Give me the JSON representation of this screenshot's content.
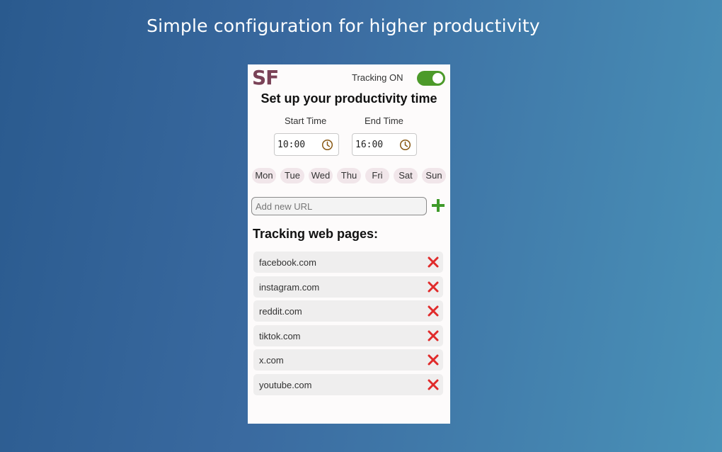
{
  "headline": "Simple configuration for higher productivity",
  "popup": {
    "logo": "SF",
    "tracking_label": "Tracking ON",
    "tracking_enabled": true,
    "title": "Set up your productivity time",
    "start_time": {
      "label": "Start Time",
      "value": "10:00"
    },
    "end_time": {
      "label": "End Time",
      "value": "16:00"
    },
    "days": [
      {
        "label": "Mon"
      },
      {
        "label": "Tue"
      },
      {
        "label": "Wed"
      },
      {
        "label": "Thu"
      },
      {
        "label": "Fri"
      },
      {
        "label": "Sat"
      },
      {
        "label": "Sun"
      }
    ],
    "url_input": {
      "placeholder": "Add new URL",
      "value": ""
    },
    "list_title": "Tracking web pages:",
    "sites": [
      {
        "name": "facebook.com"
      },
      {
        "name": "instagram.com"
      },
      {
        "name": "reddit.com"
      },
      {
        "name": "tiktok.com"
      },
      {
        "name": "x.com"
      },
      {
        "name": "youtube.com"
      }
    ]
  },
  "colors": {
    "toggle_on": "#4c9a2a",
    "add_icon": "#3f9a2a",
    "remove_icon": "#e02a2a",
    "logo": "#7a4257",
    "day_chip": "#f1e6ea"
  },
  "icons": {
    "clock": "clock-icon",
    "add": "plus-icon",
    "remove": "close-icon"
  }
}
